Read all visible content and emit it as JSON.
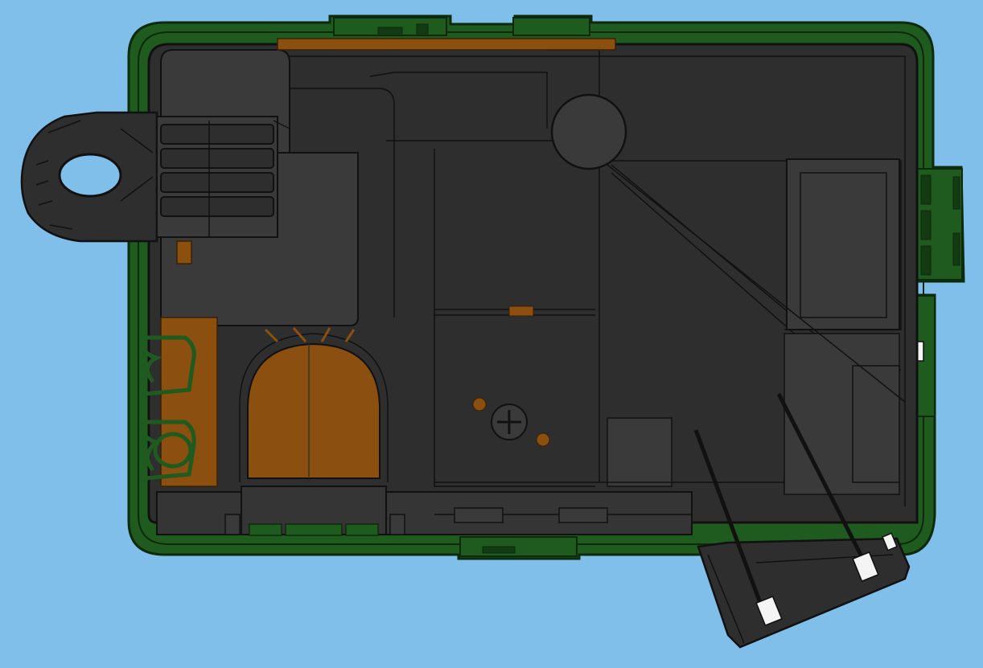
{
  "view": {
    "background_color": "#7fbfea"
  },
  "colors": {
    "housing_dark": "#2e2e2e",
    "housing_mid": "#353535",
    "housing_light": "#3a3a3a",
    "edge_line": "#111111",
    "pcb_green": "#1f5a1f",
    "pcb_green_dark": "#123b12",
    "copper": "#8b4f0f",
    "copper_light": "#a65e12",
    "slot_white": "#f4f4f4"
  },
  "parts": {
    "mounting_tab": "mounting-tab-with-oval-hole",
    "top_left_connector": "multi-pin-connector",
    "round_boss": "cylindrical-boss",
    "center_screw": "cross-head-screw",
    "copper_window": "arched-copper-window",
    "bottom_connector": "edge-connector",
    "side_plug": "side-plug",
    "angled_vent": "angled-vent-housing",
    "spring_clips": "spring-contact-clips"
  }
}
